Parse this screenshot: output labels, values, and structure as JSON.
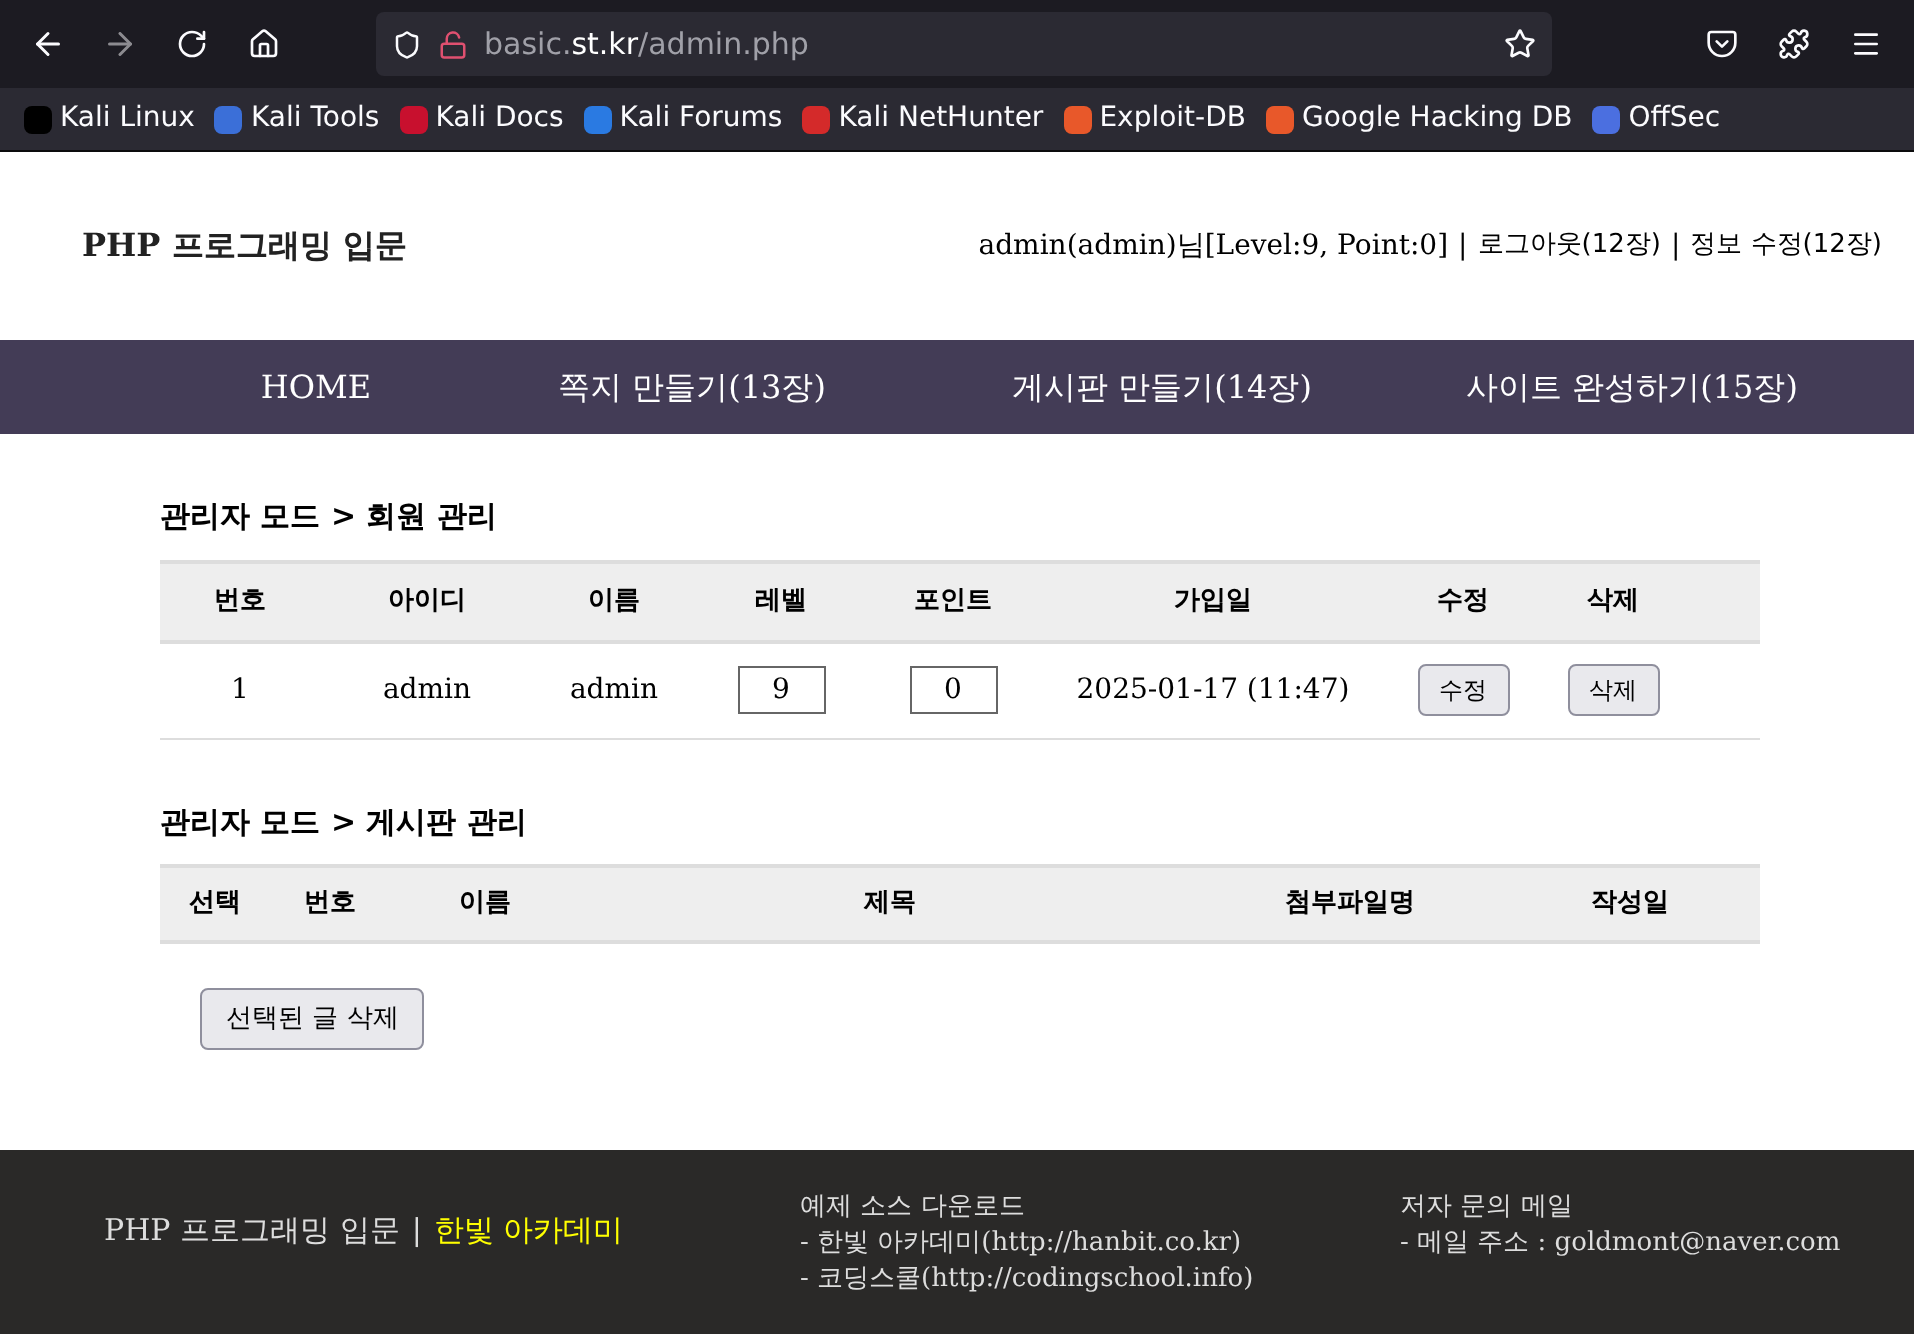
{
  "browser": {
    "url_host": "basic.",
    "url_domain": "st.kr",
    "url_path": "/admin.php"
  },
  "bookmarks": [
    {
      "label": "Kali Linux",
      "color": "#000000"
    },
    {
      "label": "Kali Tools",
      "color": "#3b6fd8"
    },
    {
      "label": "Kali Docs",
      "color": "#c8102e"
    },
    {
      "label": "Kali Forums",
      "color": "#2a7ae2"
    },
    {
      "label": "Kali NetHunter",
      "color": "#d42a2a"
    },
    {
      "label": "Exploit-DB",
      "color": "#e8582a"
    },
    {
      "label": "Google Hacking DB",
      "color": "#e8582a"
    },
    {
      "label": "OffSec",
      "color": "#4b6fe0"
    }
  ],
  "header": {
    "title": "PHP 프로그래밍 입문",
    "user_info": "admin(admin)님[Level:9, Point:0]",
    "links": [
      {
        "separator": "|",
        "label": "로그아웃(12장)"
      },
      {
        "separator": "|",
        "label": "정보 수정(12장)"
      }
    ]
  },
  "nav": [
    "HOME",
    "쪽지 만들기(13장)",
    "게시판 만들기(14장)",
    "사이트 완성하기(15장)"
  ],
  "members": {
    "title": "관리자 모드 > 회원 관리",
    "columns": [
      "번호",
      "아이디",
      "이름",
      "레벨",
      "포인트",
      "가입일",
      "수정",
      "삭제"
    ],
    "rows": [
      {
        "number": "1",
        "id": "admin",
        "name": "admin",
        "level_value": "9",
        "point_value": "0",
        "joined": "2025-01-17 (11:47)",
        "edit": "수정",
        "delete": "삭제"
      }
    ]
  },
  "board": {
    "title": "관리자 모드 > 게시판 관리",
    "columns": [
      "선택",
      "번호",
      "이름",
      "제목",
      "첨부파일명",
      "작성일"
    ],
    "delete_button": "선택된 글 삭제"
  },
  "footer": {
    "title": "PHP 프로그래밍 입문",
    "separator": "|",
    "brand": "한빛 아카데미",
    "downloads": [
      "예제 소스 다운로드",
      "- 한빛 아카데미(http://hanbit.co.kr)",
      "- 코딩스쿨(http://codingschool.info)"
    ],
    "contact": [
      "저자 문의 메일",
      "- 메일 주소 : goldmont@naver.com"
    ]
  }
}
